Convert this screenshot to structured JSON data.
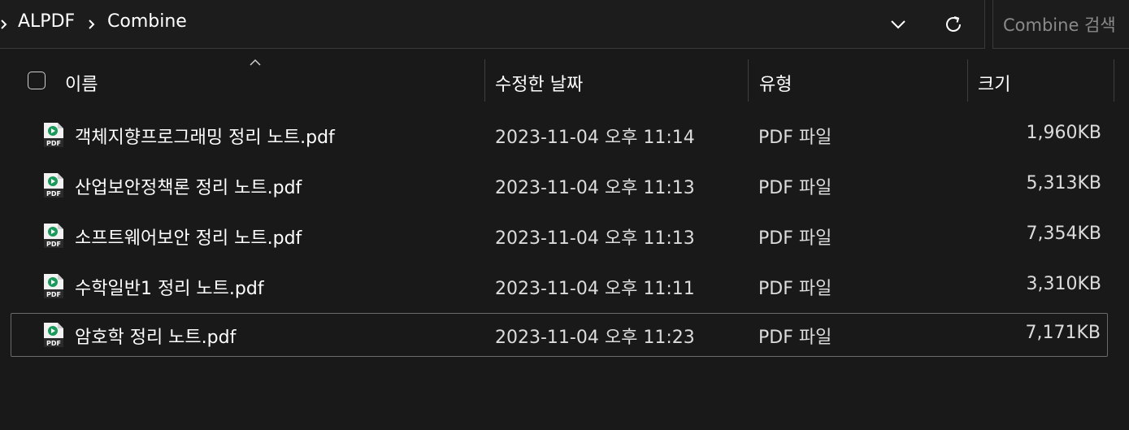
{
  "breadcrumb": {
    "items": [
      "ALPDF",
      "Combine"
    ]
  },
  "search": {
    "placeholder": "Combine 검색"
  },
  "columns": {
    "name": "이름",
    "date": "수정한 날짜",
    "type": "유형",
    "size": "크기"
  },
  "files": [
    {
      "name": "객체지향프로그래밍 정리 노트.pdf",
      "date": "2023-11-04 오후 11:14",
      "type": "PDF 파일",
      "size": "1,960KB"
    },
    {
      "name": "산업보안정책론 정리 노트.pdf",
      "date": "2023-11-04 오후 11:13",
      "type": "PDF 파일",
      "size": "5,313KB"
    },
    {
      "name": "소프트웨어보안 정리 노트.pdf",
      "date": "2023-11-04 오후 11:13",
      "type": "PDF 파일",
      "size": "7,354KB"
    },
    {
      "name": "수학일반1 정리 노트.pdf",
      "date": "2023-11-04 오후 11:11",
      "type": "PDF 파일",
      "size": "3,310KB"
    },
    {
      "name": "암호학 정리 노트.pdf",
      "date": "2023-11-04 오후 11:23",
      "type": "PDF 파일",
      "size": "7,171KB"
    }
  ],
  "file_icon_label": "PDF",
  "selected_row": 4,
  "colors": {
    "background": "#191919",
    "icon_accent": "#1a9a5a"
  }
}
